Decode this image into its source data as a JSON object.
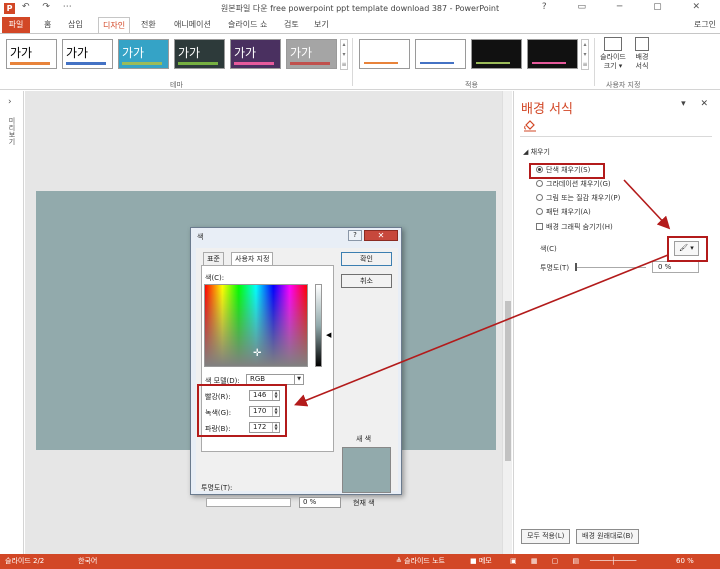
{
  "window": {
    "title": "원본파일 다운 free powerpoint ppt template download 387 - PowerPoint",
    "app_icon": "P",
    "qat": "↶ ↷ ⋯",
    "controls": "? ▭ ─ ▢ ✕"
  },
  "tabs": {
    "items": [
      {
        "label": "파일",
        "kind": "file"
      },
      {
        "label": "홈"
      },
      {
        "label": "삽입"
      },
      {
        "label": "디자인",
        "kind": "active"
      },
      {
        "label": "전환"
      },
      {
        "label": "애니메이션"
      },
      {
        "label": "슬라이드 쇼"
      },
      {
        "label": "검토"
      },
      {
        "label": "보기"
      }
    ],
    "login": "로그인"
  },
  "ribbon": {
    "themes": [
      {
        "text": "가가",
        "bg": "#ffffff",
        "fg": "#000000",
        "bar": "#e8833a"
      },
      {
        "text": "가가",
        "bg": "#ffffff",
        "fg": "#000000",
        "bar": "#4472c4"
      },
      {
        "text": "가가",
        "bg": "#35a3c6",
        "fg": "#ffffff",
        "bar": "#9bbb59"
      },
      {
        "text": "가가",
        "bg": "#2d3a3a",
        "fg": "#ffffff",
        "bar": "#76b041"
      },
      {
        "text": "가가",
        "bg": "#4a3060",
        "fg": "#ffffff",
        "bar": "#e65a9c"
      },
      {
        "text": "가가",
        "bg": "#a5a5a5",
        "fg": "#ffffff",
        "bar": "#c0504d"
      }
    ],
    "theme_group": "테마",
    "variants": [
      {
        "bg": "#ffffff",
        "bar": "#e8833a"
      },
      {
        "bg": "#ffffff",
        "bar": "#4472c4"
      },
      {
        "bg": "#111111",
        "bar": "#9bbb59"
      },
      {
        "bg": "#111111",
        "bar": "#e65a9c"
      }
    ],
    "variant_group": "적용",
    "slide_size": "슬라이드\n크기 ▾",
    "bg_format": "배경\n서식",
    "customize_group": "사용자 지정"
  },
  "thumbs": {
    "chevron": "›",
    "vertical_label": "미리보기"
  },
  "pane": {
    "title": "배경 서식",
    "controls": "▾ ✕",
    "section": "◢ 채우기",
    "options": [
      {
        "label": "단색 채우기(S)",
        "checked": true
      },
      {
        "label": "그라데이션 채우기(G)",
        "checked": false
      },
      {
        "label": "그림 또는 질감 채우기(P)",
        "checked": false
      },
      {
        "label": "패턴 채우기(A)",
        "checked": false
      }
    ],
    "hide_graphics": "배경 그래픽 숨기기(H)",
    "color_label": "색(C)",
    "color_button": "🖌 ▾",
    "transparency_label": "투명도(T)",
    "transparency_value": "0 %",
    "apply_all": "모두 적용(L)",
    "reset": "배경 원래대로(B)"
  },
  "dialog": {
    "title": "색",
    "help": "?",
    "close": "✕",
    "tab_standard": "표준",
    "tab_custom": "사용자 지정",
    "colors_label": "색(C):",
    "color_model_label": "색 모델(D):",
    "color_model_value": "RGB",
    "red_label": "빨강(R):",
    "red_value": "146",
    "green_label": "녹색(G):",
    "green_value": "170",
    "blue_label": "파랑(B):",
    "blue_value": "172",
    "ok": "확인",
    "cancel": "취소",
    "new_label": "새 색",
    "current_label": "현재 색",
    "transparency_label": "투명도(T):",
    "transparency_value": "0 %",
    "current_color": "#92aaac"
  },
  "status": {
    "slide": "슬라이드 2/2",
    "lang": "한국어",
    "notes": "≜ 슬라이드 노트",
    "comments": "■ 메모",
    "zoom": "60 %",
    "views": "▣ ▦ ▢ ▤"
  }
}
